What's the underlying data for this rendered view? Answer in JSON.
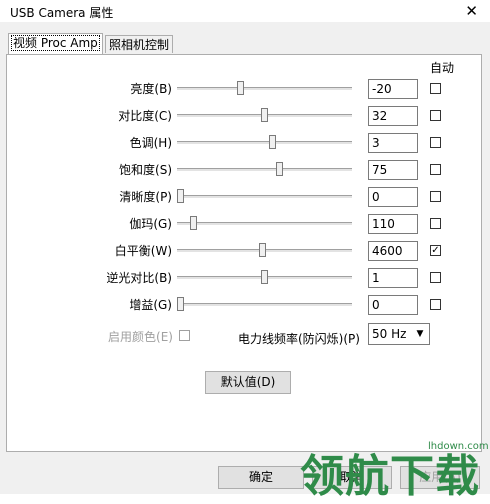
{
  "window": {
    "title": "USB Camera 属性",
    "close_glyph": "✕"
  },
  "tabs": [
    {
      "label": "视频 Proc Amp",
      "active": true
    },
    {
      "label": "照相机控制",
      "active": false
    }
  ],
  "auto_header": "自动",
  "rows": [
    {
      "label": "亮度(B)",
      "value": "-20",
      "pos": 0.36,
      "auto": false,
      "ticks": false
    },
    {
      "label": "对比度(C)",
      "value": "32",
      "pos": 0.5,
      "auto": false,
      "ticks": false
    },
    {
      "label": "色调(H)",
      "value": "3",
      "pos": 0.55,
      "auto": false,
      "ticks": false
    },
    {
      "label": "饱和度(S)",
      "value": "75",
      "pos": 0.59,
      "auto": false,
      "ticks": false
    },
    {
      "label": "清晰度(P)",
      "value": "0",
      "pos": 0.0,
      "auto": false,
      "ticks": false
    },
    {
      "label": "伽玛(G)",
      "value": "110",
      "pos": 0.08,
      "auto": false,
      "ticks": false
    },
    {
      "label": "白平衡(W)",
      "value": "4600",
      "pos": 0.49,
      "auto": true,
      "ticks": true
    },
    {
      "label": "逆光对比(B)",
      "value": "1",
      "pos": 0.5,
      "auto": false,
      "ticks": true
    },
    {
      "label": "增益(G)",
      "value": "0",
      "pos": 0.0,
      "auto": false,
      "ticks": false
    }
  ],
  "enable_color": {
    "label": "启用颜色(E)",
    "checked": false
  },
  "powerline": {
    "label": "电力线频率(防闪烁)(P)",
    "value": "50 Hz",
    "arrow": "▼"
  },
  "default_button": "默认值(D)",
  "bottom_buttons": {
    "ok": "确定",
    "cancel": "取消",
    "apply": "应用(A)"
  },
  "watermark": {
    "text": "领航下载",
    "url": "lhdown.com"
  }
}
